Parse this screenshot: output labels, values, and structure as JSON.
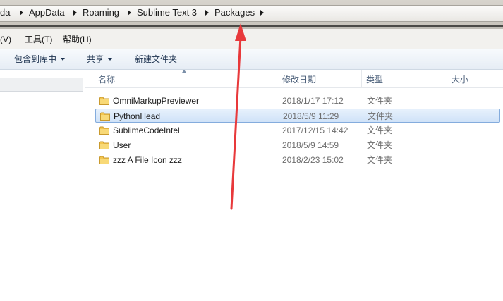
{
  "breadcrumb": {
    "items": [
      "da",
      "AppData",
      "Roaming",
      "Sublime Text 3",
      "Packages"
    ]
  },
  "menubar": {
    "items": [
      "看(V)",
      "工具(T)",
      "帮助(H)"
    ]
  },
  "toolbar": {
    "include_library_label": "包含到库中",
    "share_label": "共享",
    "new_folder_label": "新建文件夹"
  },
  "columns": {
    "name": "名称",
    "date": "修改日期",
    "type": "类型",
    "size": "大小"
  },
  "files": [
    {
      "name": "OmniMarkupPreviewer",
      "date": "2018/1/17 17:12",
      "type": "文件夹",
      "selected": false
    },
    {
      "name": "PythonHead",
      "date": "2018/5/9 11:29",
      "type": "文件夹",
      "selected": true
    },
    {
      "name": "SublimeCodeIntel",
      "date": "2017/12/15 14:42",
      "type": "文件夹",
      "selected": false
    },
    {
      "name": "User",
      "date": "2018/5/9 14:59",
      "type": "文件夹",
      "selected": false
    },
    {
      "name": "zzz A File Icon zzz",
      "date": "2018/2/23 15:02",
      "type": "文件夹",
      "selected": false
    }
  ],
  "colors": {
    "annotation_arrow": "#e8393b",
    "selection": "#cfe2f8",
    "folder": "#f3c54f"
  },
  "icons": [
    "breadcrumb-arrow-icon",
    "dropdown-icon",
    "folder-icon",
    "sort-ascending-icon"
  ]
}
